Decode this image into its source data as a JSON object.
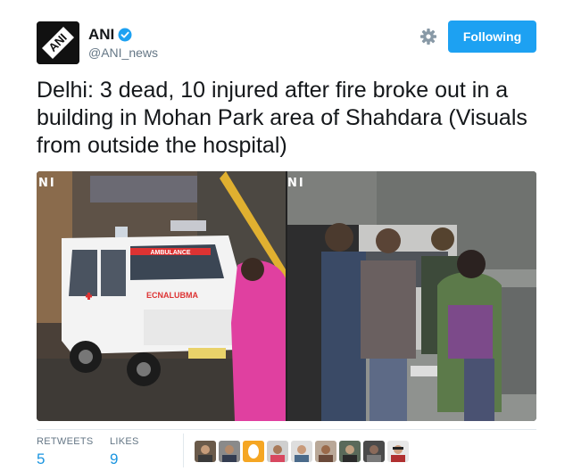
{
  "account": {
    "name": "ANI",
    "handle": "@ANI_news",
    "avatar_text": "ANI",
    "verified": true
  },
  "follow_button": {
    "label": "Following"
  },
  "tweet": {
    "text": "Delhi: 3 dead, 10 injured after fire broke out in a building in Mohan Park area of Shahdara (Visuals from outside the hospital)"
  },
  "media": {
    "left_watermark": "NI",
    "right_watermark": "NI",
    "ambulance_sign": "AMBULANCE",
    "ambulance_mirror_text": "ECNALUBMA"
  },
  "stats": {
    "retweets_label": "RETWEETS",
    "retweets_value": "5",
    "likes_label": "LIKES",
    "likes_value": "9"
  },
  "likers_count": 9,
  "colors": {
    "accent": "#1da1f2",
    "stat_value": "#1b95e0",
    "secondary_text": "#657786",
    "divider": "#e1e8ed"
  },
  "icons": [
    "settings-gear-icon",
    "verified-badge-icon"
  ]
}
